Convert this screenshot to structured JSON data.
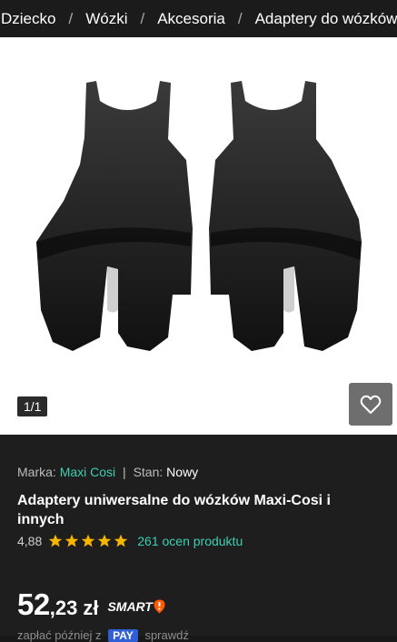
{
  "breadcrumb": {
    "items": [
      "Dziecko",
      "Wózki",
      "Akcesoria",
      "Adaptery do wózków"
    ],
    "separator": "/"
  },
  "gallery": {
    "counter": "1/1",
    "favorite_icon": "heart-icon"
  },
  "product": {
    "brand_label": "Marka:",
    "brand_value": "Maxi Cosi",
    "condition_label": "Stan:",
    "condition_value": "Nowy",
    "title": "Adaptery uniwersalne do wózków Maxi-Cosi i innych",
    "rating_score": "4,88",
    "rating_stars": 5,
    "reviews_text": "261 ocen produktu"
  },
  "price": {
    "integer": "52",
    "decimal": ",23",
    "currency": "zł",
    "smart_label": "SMART",
    "smart_icon": "smart-exclamation-icon"
  },
  "payment": {
    "prefix": "zapłać później z",
    "badge": "PAY",
    "suffix": "sprawdź"
  },
  "colors": {
    "accent": "#3ccfb3",
    "star": "#f6b600",
    "smart_badge": "#ff5a00",
    "background": "#1e1e1e"
  }
}
